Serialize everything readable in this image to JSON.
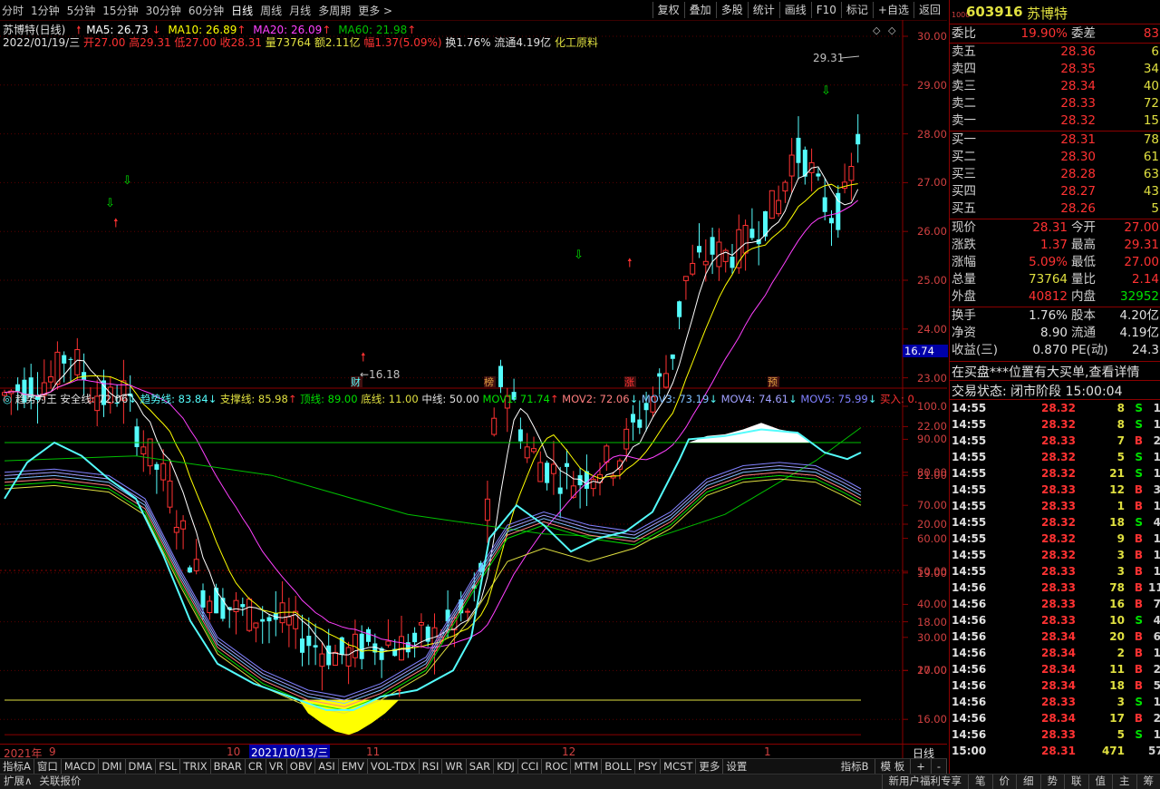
{
  "toolbar": {
    "periods": [
      "分时",
      "1分钟",
      "5分钟",
      "15分钟",
      "30分钟",
      "60分钟",
      "日线",
      "周线",
      "月线",
      "多周期",
      "更多 >"
    ],
    "active": "日线",
    "tools": [
      "复权",
      "叠加",
      "多股",
      "统计",
      "画线",
      "F10",
      "标记",
      "+自选",
      "返回"
    ]
  },
  "chart_header": {
    "title": "苏博特(日线)",
    "ma5": "MA5: 26.73",
    "ma10": "MA10: 26.89",
    "ma20": "MA20: 26.09",
    "ma60": "MA60: 21.98",
    "date": "2022/01/19/三",
    "open": "开27.00",
    "high": "高29.31",
    "low": "低27.00",
    "close": "收28.31",
    "vol": "量73764",
    "amount": "额2.11亿",
    "change": "幅1.37(5.09%)",
    "turnover": "换1.76%",
    "float": "流通4.19亿",
    "sector": "化工原料"
  },
  "colors": {
    "up": "#ff3232",
    "down": "#54fcfc",
    "ma5": "#ffffff",
    "ma10": "#ffff00",
    "ma20": "#ff40ff",
    "ma60": "#00c000",
    "axis": "#d04040"
  },
  "price_axis": [
    "30.00",
    "29.00",
    "28.00",
    "27.00",
    "26.00",
    "25.00",
    "24.00",
    "23.00",
    "22.00",
    "21.00",
    "20.00",
    "19.00",
    "18.00",
    "17.00",
    "16.00"
  ],
  "current_price_tag": "16.74",
  "annotations": {
    "high": "29.31",
    "low": "16.18",
    "markers": [
      "财",
      "榜",
      "涨",
      "预"
    ]
  },
  "indicator_header": {
    "name": "趋势为王",
    "safe": "安全线: 72.06",
    "trend": "趋势线: 83.84",
    "support": "支撑线: 85.98",
    "top": "顶线: 89.00",
    "bottom": "底线: 11.00",
    "mid": "中线: 50.00",
    "mov1": "MOV1: 71.74",
    "mov2": "MOV2: 72.06",
    "mov3": "MOV3: 73.19",
    "mov4": "MOV4: 74.61",
    "mov5": "MOV5: 75.99",
    "buy": "买入: 0."
  },
  "indicator_axis": [
    "100.0",
    "90.00",
    "80.00",
    "70.00",
    "60.00",
    "50.00",
    "40.00",
    "30.00",
    "20.00"
  ],
  "date_row": {
    "year": "2021年",
    "m9": "9",
    "m10": "10",
    "sel": "2021/10/13/三",
    "m11": "11",
    "m12": "12",
    "m1": "1",
    "period": "日线"
  },
  "indicator_tabs": [
    "指标A",
    "窗口",
    "MACD",
    "DMI",
    "DMA",
    "FSL",
    "TRIX",
    "BRAR",
    "CR",
    "VR",
    "OBV",
    "ASI",
    "EMV",
    "VOL-TDX",
    "RSI",
    "WR",
    "SAR",
    "KDJ",
    "CCI",
    "ROC",
    "MTM",
    "BOLL",
    "PSY",
    "MCST",
    "更多",
    "设置"
  ],
  "indicator_tabs_right": [
    "指标B",
    "模 板",
    "+",
    "-"
  ],
  "status_left": [
    "扩展∧",
    "关联报价"
  ],
  "status_right": [
    "新用户福利专享",
    "笔",
    "价",
    "细",
    "势",
    "联",
    "值",
    "主",
    "筹"
  ],
  "quote": {
    "code": "603916",
    "name": "苏博特",
    "tag": "1000",
    "webi": "委比",
    "webi_val": "19.90%",
    "wecha": "委差",
    "wecha_val": "83",
    "asks": [
      {
        "label": "卖五",
        "price": "28.36",
        "vol": "6"
      },
      {
        "label": "卖四",
        "price": "28.35",
        "vol": "34"
      },
      {
        "label": "卖三",
        "price": "28.34",
        "vol": "40"
      },
      {
        "label": "卖二",
        "price": "28.33",
        "vol": "72"
      },
      {
        "label": "卖一",
        "price": "28.32",
        "vol": "15"
      }
    ],
    "bids": [
      {
        "label": "买一",
        "price": "28.31",
        "vol": "78"
      },
      {
        "label": "买二",
        "price": "28.30",
        "vol": "61"
      },
      {
        "label": "买三",
        "price": "28.28",
        "vol": "63"
      },
      {
        "label": "买四",
        "price": "28.27",
        "vol": "43"
      },
      {
        "label": "买五",
        "price": "28.26",
        "vol": "5"
      }
    ],
    "stats": [
      {
        "l1": "现价",
        "v1": "28.31",
        "c1": "#ff3232",
        "l2": "今开",
        "v2": "27.00",
        "c2": "#ff3232"
      },
      {
        "l1": "涨跌",
        "v1": "1.37",
        "c1": "#ff3232",
        "l2": "最高",
        "v2": "29.31",
        "c2": "#ff3232"
      },
      {
        "l1": "涨幅",
        "v1": "5.09%",
        "c1": "#ff3232",
        "l2": "最低",
        "v2": "27.00",
        "c2": "#ff3232"
      },
      {
        "l1": "总量",
        "v1": "73764",
        "c1": "#e0e040",
        "l2": "量比",
        "v2": "2.14",
        "c2": "#ff3232"
      },
      {
        "l1": "外盘",
        "v1": "40812",
        "c1": "#ff3232",
        "l2": "内盘",
        "v2": "32952",
        "c2": "#00e000"
      }
    ],
    "stats2": [
      {
        "l1": "换手",
        "v1": "1.76%",
        "l2": "股本",
        "v2": "4.20亿"
      },
      {
        "l1": "净资",
        "v1": "8.90",
        "l2": "流通",
        "v2": "4.19亿"
      },
      {
        "l1": "收益(三)",
        "v1": "0.870",
        "l2": "PE(动)",
        "v2": "24.3"
      }
    ],
    "notice": "在买盘***位置有大买单,查看详情",
    "trade_status": "交易状态: 闭市阶段 15:00:04",
    "ticks": [
      {
        "t": "14:55",
        "p": "28.32",
        "v": "8",
        "s": "S",
        "n": "1"
      },
      {
        "t": "14:55",
        "p": "28.32",
        "v": "8",
        "s": "S",
        "n": "1"
      },
      {
        "t": "14:55",
        "p": "28.33",
        "v": "7",
        "s": "B",
        "n": "2"
      },
      {
        "t": "14:55",
        "p": "28.32",
        "v": "5",
        "s": "S",
        "n": "1"
      },
      {
        "t": "14:55",
        "p": "28.32",
        "v": "21",
        "s": "S",
        "n": "1"
      },
      {
        "t": "14:55",
        "p": "28.33",
        "v": "12",
        "s": "B",
        "n": "3"
      },
      {
        "t": "14:55",
        "p": "28.33",
        "v": "1",
        "s": "B",
        "n": "1"
      },
      {
        "t": "14:55",
        "p": "28.32",
        "v": "18",
        "s": "S",
        "n": "4"
      },
      {
        "t": "14:55",
        "p": "28.32",
        "v": "9",
        "s": "B",
        "n": "1"
      },
      {
        "t": "14:55",
        "p": "28.32",
        "v": "3",
        "s": "B",
        "n": "1"
      },
      {
        "t": "14:55",
        "p": "28.33",
        "v": "3",
        "s": "B",
        "n": "1"
      },
      {
        "t": "14:56",
        "p": "28.33",
        "v": "78",
        "s": "B",
        "n": "11"
      },
      {
        "t": "14:56",
        "p": "28.33",
        "v": "16",
        "s": "B",
        "n": "7"
      },
      {
        "t": "14:56",
        "p": "28.33",
        "v": "10",
        "s": "S",
        "n": "4"
      },
      {
        "t": "14:56",
        "p": "28.34",
        "v": "20",
        "s": "B",
        "n": "6"
      },
      {
        "t": "14:56",
        "p": "28.34",
        "v": "2",
        "s": "B",
        "n": "1"
      },
      {
        "t": "14:56",
        "p": "28.34",
        "v": "11",
        "s": "B",
        "n": "2"
      },
      {
        "t": "14:56",
        "p": "28.34",
        "v": "18",
        "s": "B",
        "n": "5"
      },
      {
        "t": "14:56",
        "p": "28.33",
        "v": "3",
        "s": "S",
        "n": "1"
      },
      {
        "t": "14:56",
        "p": "28.34",
        "v": "17",
        "s": "B",
        "n": "2"
      },
      {
        "t": "14:56",
        "p": "28.33",
        "v": "5",
        "s": "S",
        "n": "1"
      },
      {
        "t": "15:00",
        "p": "28.31",
        "v": "471",
        "s": "",
        "n": "57"
      }
    ]
  }
}
